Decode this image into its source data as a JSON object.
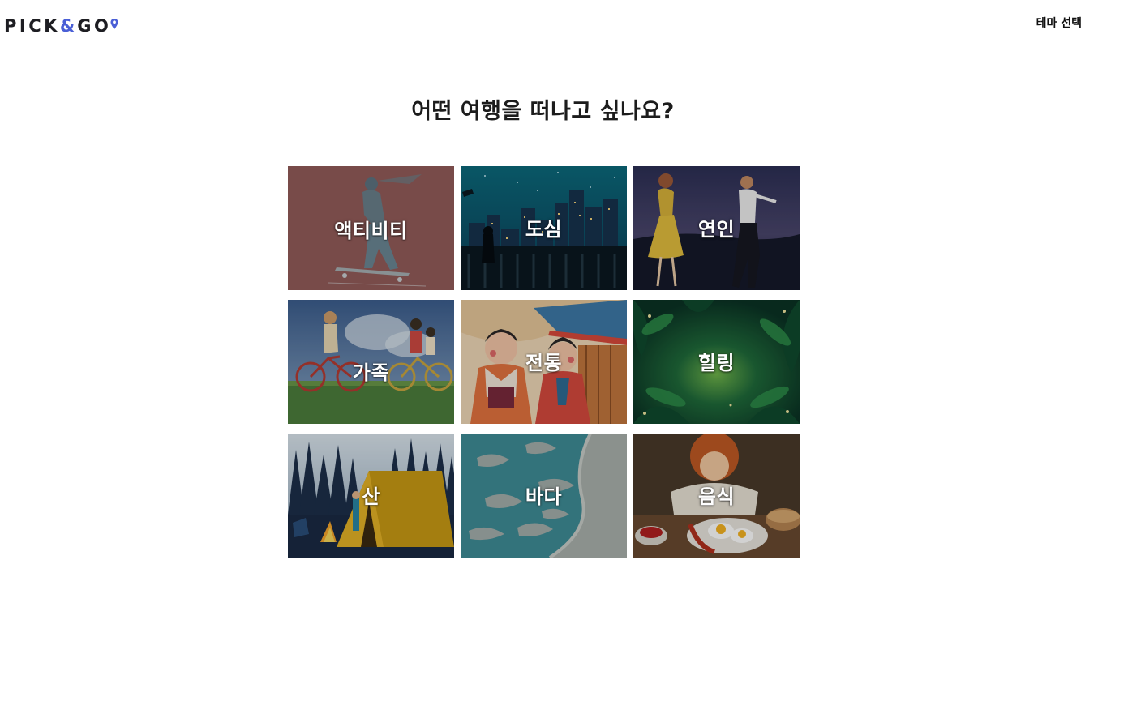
{
  "header": {
    "logo": {
      "part1": "PICK",
      "amp": "&",
      "part2": "GO"
    },
    "theme_link": "테마 선택"
  },
  "main": {
    "title": "어떤 여행을 떠나고 싶나요?"
  },
  "themes": [
    {
      "label": "액티비티",
      "icon": "skateboarder-illustration"
    },
    {
      "label": "도심",
      "icon": "city-night-illustration"
    },
    {
      "label": "연인",
      "icon": "dancing-couple-illustration"
    },
    {
      "label": "가족",
      "icon": "family-bicycle-illustration"
    },
    {
      "label": "전통",
      "icon": "hanbok-illustration"
    },
    {
      "label": "힐링",
      "icon": "forest-illustration"
    },
    {
      "label": "산",
      "icon": "camping-tent-illustration"
    },
    {
      "label": "바다",
      "icon": "sea-shore-illustration"
    },
    {
      "label": "음식",
      "icon": "breakfast-illustration"
    }
  ],
  "colors": {
    "brand_accent": "#4a5fd6",
    "text": "#1c1c1c"
  }
}
